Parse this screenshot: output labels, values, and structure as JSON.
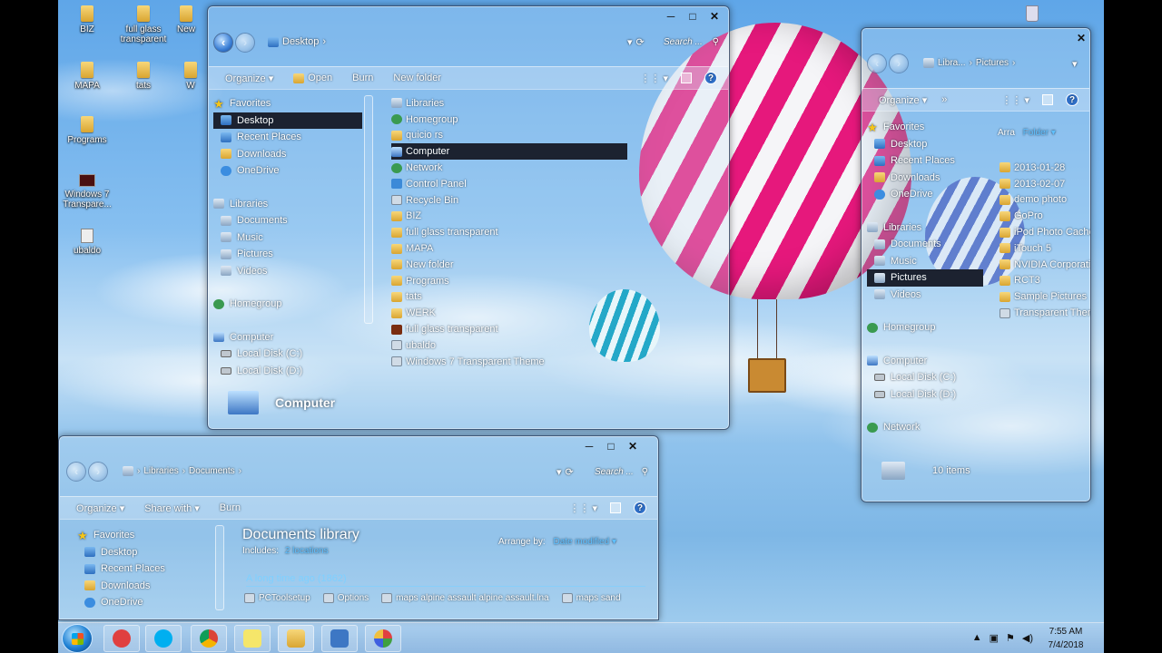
{
  "desktop_icons": [
    {
      "label": "BIZ",
      "kind": "folder"
    },
    {
      "label": "full glass transparent",
      "kind": "folder"
    },
    {
      "label": "New",
      "kind": "folder"
    },
    {
      "label": "MAPA",
      "kind": "folder"
    },
    {
      "label": "tats",
      "kind": "folder"
    },
    {
      "label": "W",
      "kind": "folder"
    },
    {
      "label": "Programs",
      "kind": "folder"
    },
    {
      "label": "Windows 7 Transpare...",
      "kind": "app"
    },
    {
      "label": "ubaldo",
      "kind": "file"
    }
  ],
  "win_desktop": {
    "address": "Desktop",
    "search_placeholder": "Search ...",
    "toolbar": {
      "organize": "Organize",
      "open": "Open",
      "burn": "Burn",
      "new_folder": "New folder"
    },
    "nav": {
      "favorites": "Favorites",
      "desktop": "Desktop",
      "recent": "Recent Places",
      "downloads": "Downloads",
      "onedrive": "OneDrive",
      "libraries": "Libraries",
      "documents": "Documents",
      "music": "Music",
      "pictures": "Pictures",
      "videos": "Videos",
      "homegroup": "Homegroup",
      "computer": "Computer",
      "local_c": "Local Disk (C:)",
      "local_d": "Local Disk (D:)"
    },
    "files": [
      {
        "name": "Libraries",
        "icon": "lib"
      },
      {
        "name": "Homegroup",
        "icon": "net"
      },
      {
        "name": "quicio rs",
        "icon": "fold"
      },
      {
        "name": "Computer",
        "icon": "pc",
        "selected": true
      },
      {
        "name": "Network",
        "icon": "net"
      },
      {
        "name": "Control Panel",
        "icon": "cp"
      },
      {
        "name": "Recycle Bin",
        "icon": "bin"
      },
      {
        "name": "BIZ",
        "icon": "fold"
      },
      {
        "name": "full glass transparent",
        "icon": "fold"
      },
      {
        "name": "MAPA",
        "icon": "fold"
      },
      {
        "name": "New folder",
        "icon": "fold"
      },
      {
        "name": "Programs",
        "icon": "fold"
      },
      {
        "name": "tats",
        "icon": "fold"
      },
      {
        "name": "WERK",
        "icon": "fold"
      },
      {
        "name": "full glass transparent",
        "icon": "app"
      },
      {
        "name": "ubaldo",
        "icon": "bin"
      },
      {
        "name": "Windows 7 Transparent Theme",
        "icon": "bin"
      }
    ],
    "details_title": "Computer"
  },
  "win_pictures": {
    "address": [
      "Libra...",
      "Pictures"
    ],
    "toolbar": {
      "organize": "Organize",
      "more": "»"
    },
    "arrange_label": "Arra",
    "arrange_value": "Folder",
    "nav": {
      "favorites": "Favorites",
      "desktop": "Desktop",
      "recent": "Recent Places",
      "downloads": "Downloads",
      "onedrive": "OneDrive",
      "libraries": "Libraries",
      "documents": "Documents",
      "music": "Music",
      "pictures": "Pictures",
      "videos": "Videos",
      "homegroup": "Homegroup",
      "computer": "Computer",
      "local_c": "Local Disk (C:)",
      "local_d": "Local Disk (D:)",
      "network": "Network"
    },
    "files": [
      {
        "name": "2013-01-28",
        "icon": "fold"
      },
      {
        "name": "2013-02-07",
        "icon": "fold"
      },
      {
        "name": "demo photo",
        "icon": "fold"
      },
      {
        "name": "GoPro",
        "icon": "fold"
      },
      {
        "name": "iPod Photo Cache",
        "icon": "fold"
      },
      {
        "name": "iTouch 5",
        "icon": "fold"
      },
      {
        "name": "NVIDIA Corporatio",
        "icon": "fold"
      },
      {
        "name": "RCT3",
        "icon": "fold"
      },
      {
        "name": "Sample Pictures",
        "icon": "fold"
      },
      {
        "name": "Transparent Them",
        "icon": "bin"
      }
    ],
    "item_count": "10 items"
  },
  "win_documents": {
    "address": [
      "Libraries",
      "Documents"
    ],
    "search_placeholder": "Search ...",
    "toolbar": {
      "organize": "Organize",
      "share": "Share with",
      "burn": "Burn"
    },
    "nav": {
      "favorites": "Favorites",
      "desktop": "Desktop",
      "recent": "Recent Places",
      "downloads": "Downloads",
      "onedrive": "OneDrive"
    },
    "library_title": "Documents library",
    "includes_label": "Includes:",
    "includes_value": "2 locations",
    "arrange_label": "Arrange by:",
    "arrange_value": "Date modified",
    "group_header": "A long time ago (1862)",
    "files": [
      "PCToolsetup",
      "Options",
      "maps alpine assault alpine assault.lna",
      "maps sand"
    ]
  },
  "taskbar": {
    "apps": [
      "snipping-tool",
      "skype",
      "chrome",
      "sticky-notes",
      "explorer",
      "remote-desktop",
      "paint"
    ],
    "time": "7:55 AM",
    "date": "7/4/2018"
  }
}
